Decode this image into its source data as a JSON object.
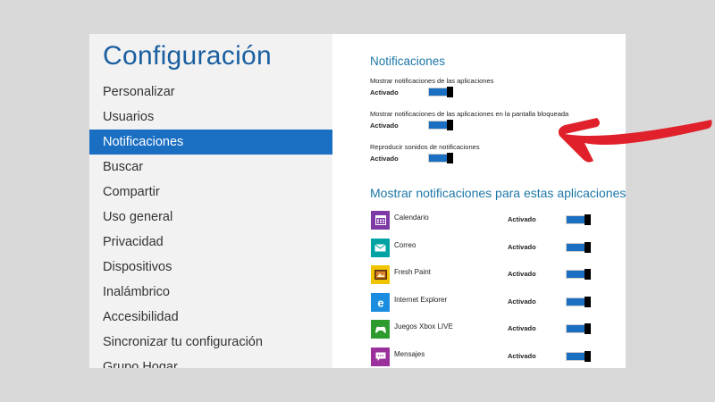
{
  "sidebar": {
    "title": "Configuración",
    "items": [
      {
        "label": "Personalizar"
      },
      {
        "label": "Usuarios"
      },
      {
        "label": "Notificaciones",
        "selected": true
      },
      {
        "label": "Buscar"
      },
      {
        "label": "Compartir"
      },
      {
        "label": "Uso general"
      },
      {
        "label": "Privacidad"
      },
      {
        "label": "Dispositivos"
      },
      {
        "label": "Inalámbrico"
      },
      {
        "label": "Accesibilidad"
      },
      {
        "label": "Sincronizar tu configuración"
      },
      {
        "label": "Grupo Hogar"
      }
    ]
  },
  "notifications": {
    "title": "Notificaciones",
    "settings": [
      {
        "label": "Mostrar notificaciones de las aplicaciones",
        "state": "Activado",
        "on": true
      },
      {
        "label": "Mostrar notificaciones de las aplicaciones en la pantalla bloqueada",
        "state": "Activado",
        "on": true
      },
      {
        "label": "Reproducir sonidos de notificaciones",
        "state": "Activado",
        "on": true
      }
    ]
  },
  "apps": {
    "title": "Mostrar notificaciones para estas aplicaciones",
    "items": [
      {
        "name": "Calendario",
        "state": "Activado",
        "icon": "calendar-icon",
        "color": "#7e3ba6"
      },
      {
        "name": "Correo",
        "state": "Activado",
        "icon": "mail-icon",
        "color": "#00a3a3"
      },
      {
        "name": "Fresh Paint",
        "state": "Activado",
        "icon": "paint-icon",
        "color": "#f0c400"
      },
      {
        "name": "Internet Explorer",
        "state": "Activado",
        "icon": "ie-icon",
        "color": "#1b8de0"
      },
      {
        "name": "Juegos Xbox LIVE",
        "state": "Activado",
        "icon": "xbox-icon",
        "color": "#2e9b2e"
      },
      {
        "name": "Mensajes",
        "state": "Activado",
        "icon": "message-icon",
        "color": "#9b2f9b"
      }
    ]
  },
  "colors": {
    "accent": "#1b6fc2",
    "annotation_arrow": "#e0202a"
  }
}
